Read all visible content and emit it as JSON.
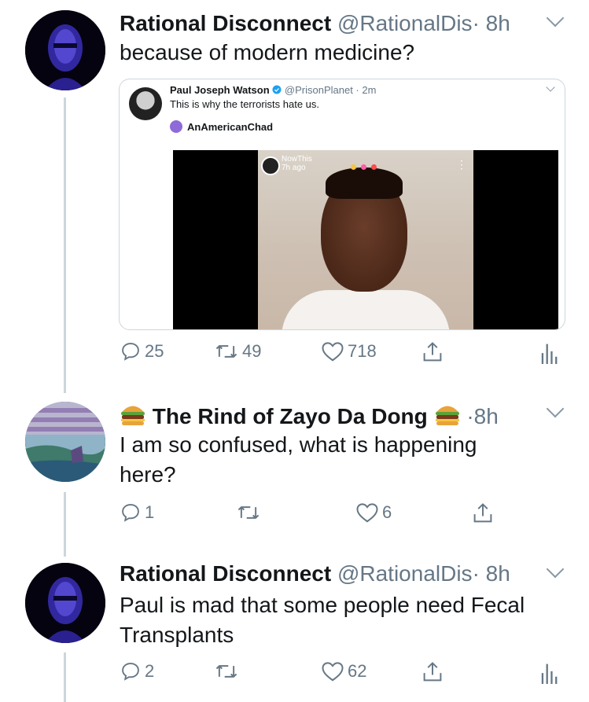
{
  "tweets": [
    {
      "name": "Rational Disconnect",
      "handle": "@RationalDis",
      "time": "8h",
      "text": "because of modern medicine?",
      "quote": {
        "name": "Paul Joseph Watson",
        "handle": "@PrisonPlanet · 2m",
        "text": "This is why the terrorists hate us.",
        "sub_account": "AnAmericanChad",
        "video": {
          "channel": "NowThis",
          "ago": "7h ago"
        }
      },
      "replies": "25",
      "retweets": "49",
      "likes": "718"
    },
    {
      "name": "The Rind of Zayo Da Dong",
      "time": "8h",
      "text": "I am so confused, what is happening here?",
      "replies": "1",
      "retweets": "",
      "likes": "6"
    },
    {
      "name": "Rational Disconnect",
      "handle": "@RationalDis",
      "time": "8h",
      "text": "Paul is mad that some people need Fecal Transplants",
      "replies": "2",
      "retweets": "",
      "likes": "62"
    }
  ],
  "separator": "·",
  "colors": {
    "text": "#14171a",
    "muted": "#657786",
    "thread_line": "#ccd6dd"
  },
  "icons": [
    "reply-icon",
    "retweet-icon",
    "like-icon",
    "share-icon",
    "analytics-icon",
    "chevron-down-icon",
    "verified-badge-icon",
    "burger-emoji-icon"
  ]
}
